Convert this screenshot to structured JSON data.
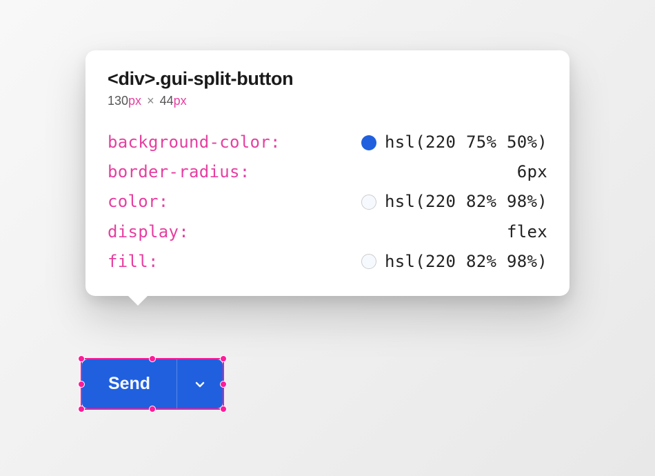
{
  "tooltip": {
    "element_tag": "<div>",
    "element_class": ".gui-split-button",
    "width_value": "130",
    "width_unit": "px",
    "times": "×",
    "height_value": "44",
    "height_unit": "px",
    "props": [
      {
        "name": "background-color:",
        "swatch": "blue",
        "value": "hsl(220 75% 50%)"
      },
      {
        "name": "border-radius:",
        "swatch": null,
        "value": "6px"
      },
      {
        "name": "color:",
        "swatch": "white",
        "value": "hsl(220 82% 98%)"
      },
      {
        "name": "display:",
        "swatch": null,
        "value": "flex"
      },
      {
        "name": "fill:",
        "swatch": "white",
        "value": "hsl(220 82% 98%)"
      }
    ]
  },
  "button": {
    "label": "Send"
  },
  "colors": {
    "accent_pink": "#e63fa0",
    "selection_pink": "#ff1b99",
    "button_bg": "hsl(220 75% 50%)",
    "button_fg": "hsl(220 82% 98%)"
  }
}
